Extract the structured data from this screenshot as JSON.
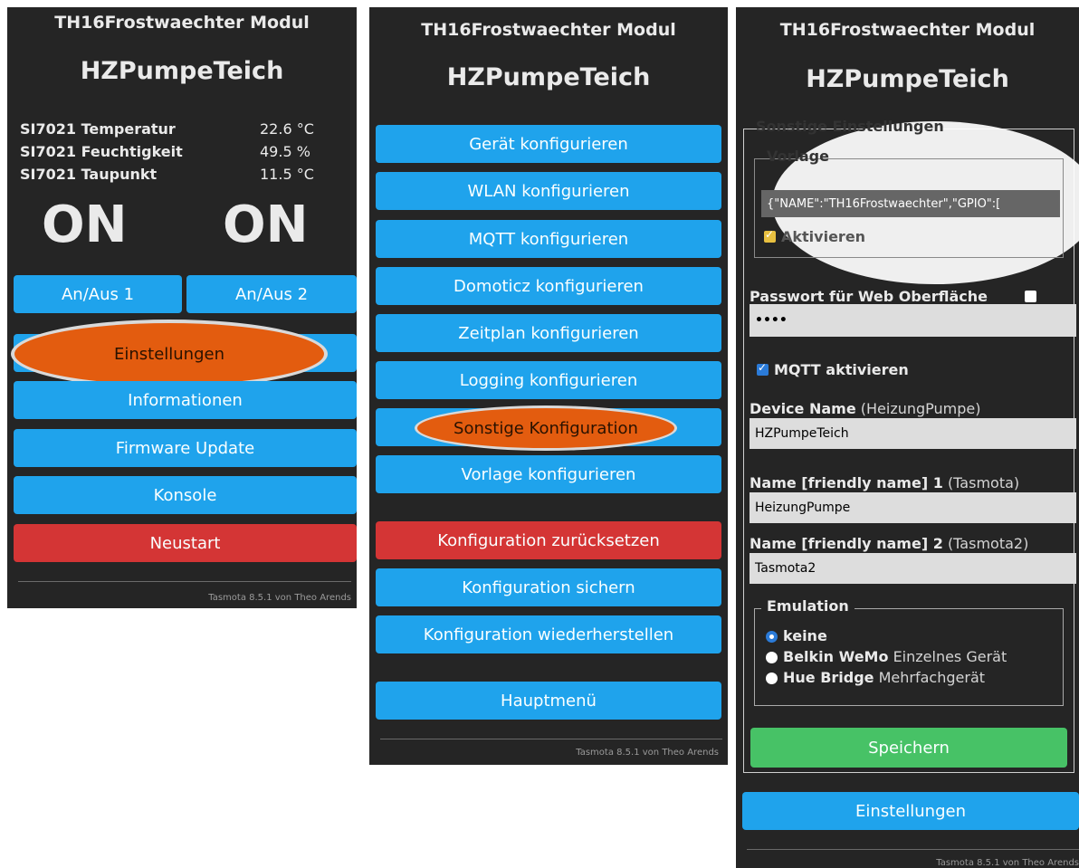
{
  "colors": {
    "panel_bg": "#252525",
    "button_blue": "#1fa3ec",
    "button_red": "#d43535",
    "button_green": "#47c266",
    "highlight_orange": "#e35c0f"
  },
  "module_title": "TH16Frostwaechter Modul",
  "device_title": "HZPumpeTeich",
  "footer": "Tasmota 8.5.1 von Theo Arends",
  "main_screen": {
    "sensors": [
      {
        "name": "SI7021 Temperatur",
        "value": "22.6 °C"
      },
      {
        "name": "SI7021 Feuchtigkeit",
        "value": "49.5 %"
      },
      {
        "name": "SI7021 Taupunkt",
        "value": "11.5 °C"
      }
    ],
    "state1": "ON",
    "state2": "ON",
    "toggle1": "An/Aus 1",
    "toggle2": "An/Aus 2",
    "buttons": {
      "settings": "Einstellungen",
      "info": "Informationen",
      "firmware": "Firmware Update",
      "console": "Konsole",
      "restart": "Neustart"
    }
  },
  "config_menu": {
    "device": "Gerät konfigurieren",
    "wlan": "WLAN konfigurieren",
    "mqtt": "MQTT konfigurieren",
    "domoticz": "Domoticz konfigurieren",
    "timer": "Zeitplan konfigurieren",
    "logging": "Logging konfigurieren",
    "other": "Sonstige Konfiguration",
    "template": "Vorlage konfigurieren",
    "reset": "Konfiguration zurücksetzen",
    "backup": "Konfiguration sichern",
    "restore": "Konfiguration wiederherstellen",
    "main_menu": "Hauptmenü"
  },
  "other_settings": {
    "legend": "Sonstige Einstellungen",
    "template_legend": "Vorlage",
    "template_value": "{\"NAME\":\"TH16Frostwaechter\",\"GPIO\":[",
    "activate_label": "Aktivieren",
    "activate_checked": true,
    "password_label": "Passwort für Web Oberfläche",
    "password_value": "••••",
    "mqtt_label": "MQTT aktivieren",
    "mqtt_checked": true,
    "device_name_label": "Device Name",
    "device_name_hint": "(HeizungPumpe)",
    "device_name_value": "HZPumpeTeich",
    "friendly1_label": "Name [friendly name] 1",
    "friendly1_hint": "(Tasmota)",
    "friendly1_value": "HeizungPumpe",
    "friendly2_label": "Name [friendly name] 2",
    "friendly2_hint": "(Tasmota2)",
    "friendly2_value": "Tasmota2",
    "emulation_legend": "Emulation",
    "emulation_options": [
      {
        "name": "keine",
        "desc": "",
        "selected": true
      },
      {
        "name": "Belkin WeMo",
        "desc": "Einzelnes Gerät",
        "selected": false
      },
      {
        "name": "Hue Bridge",
        "desc": "Mehrfachgerät",
        "selected": false
      }
    ],
    "save": "Speichern",
    "settings": "Einstellungen"
  }
}
